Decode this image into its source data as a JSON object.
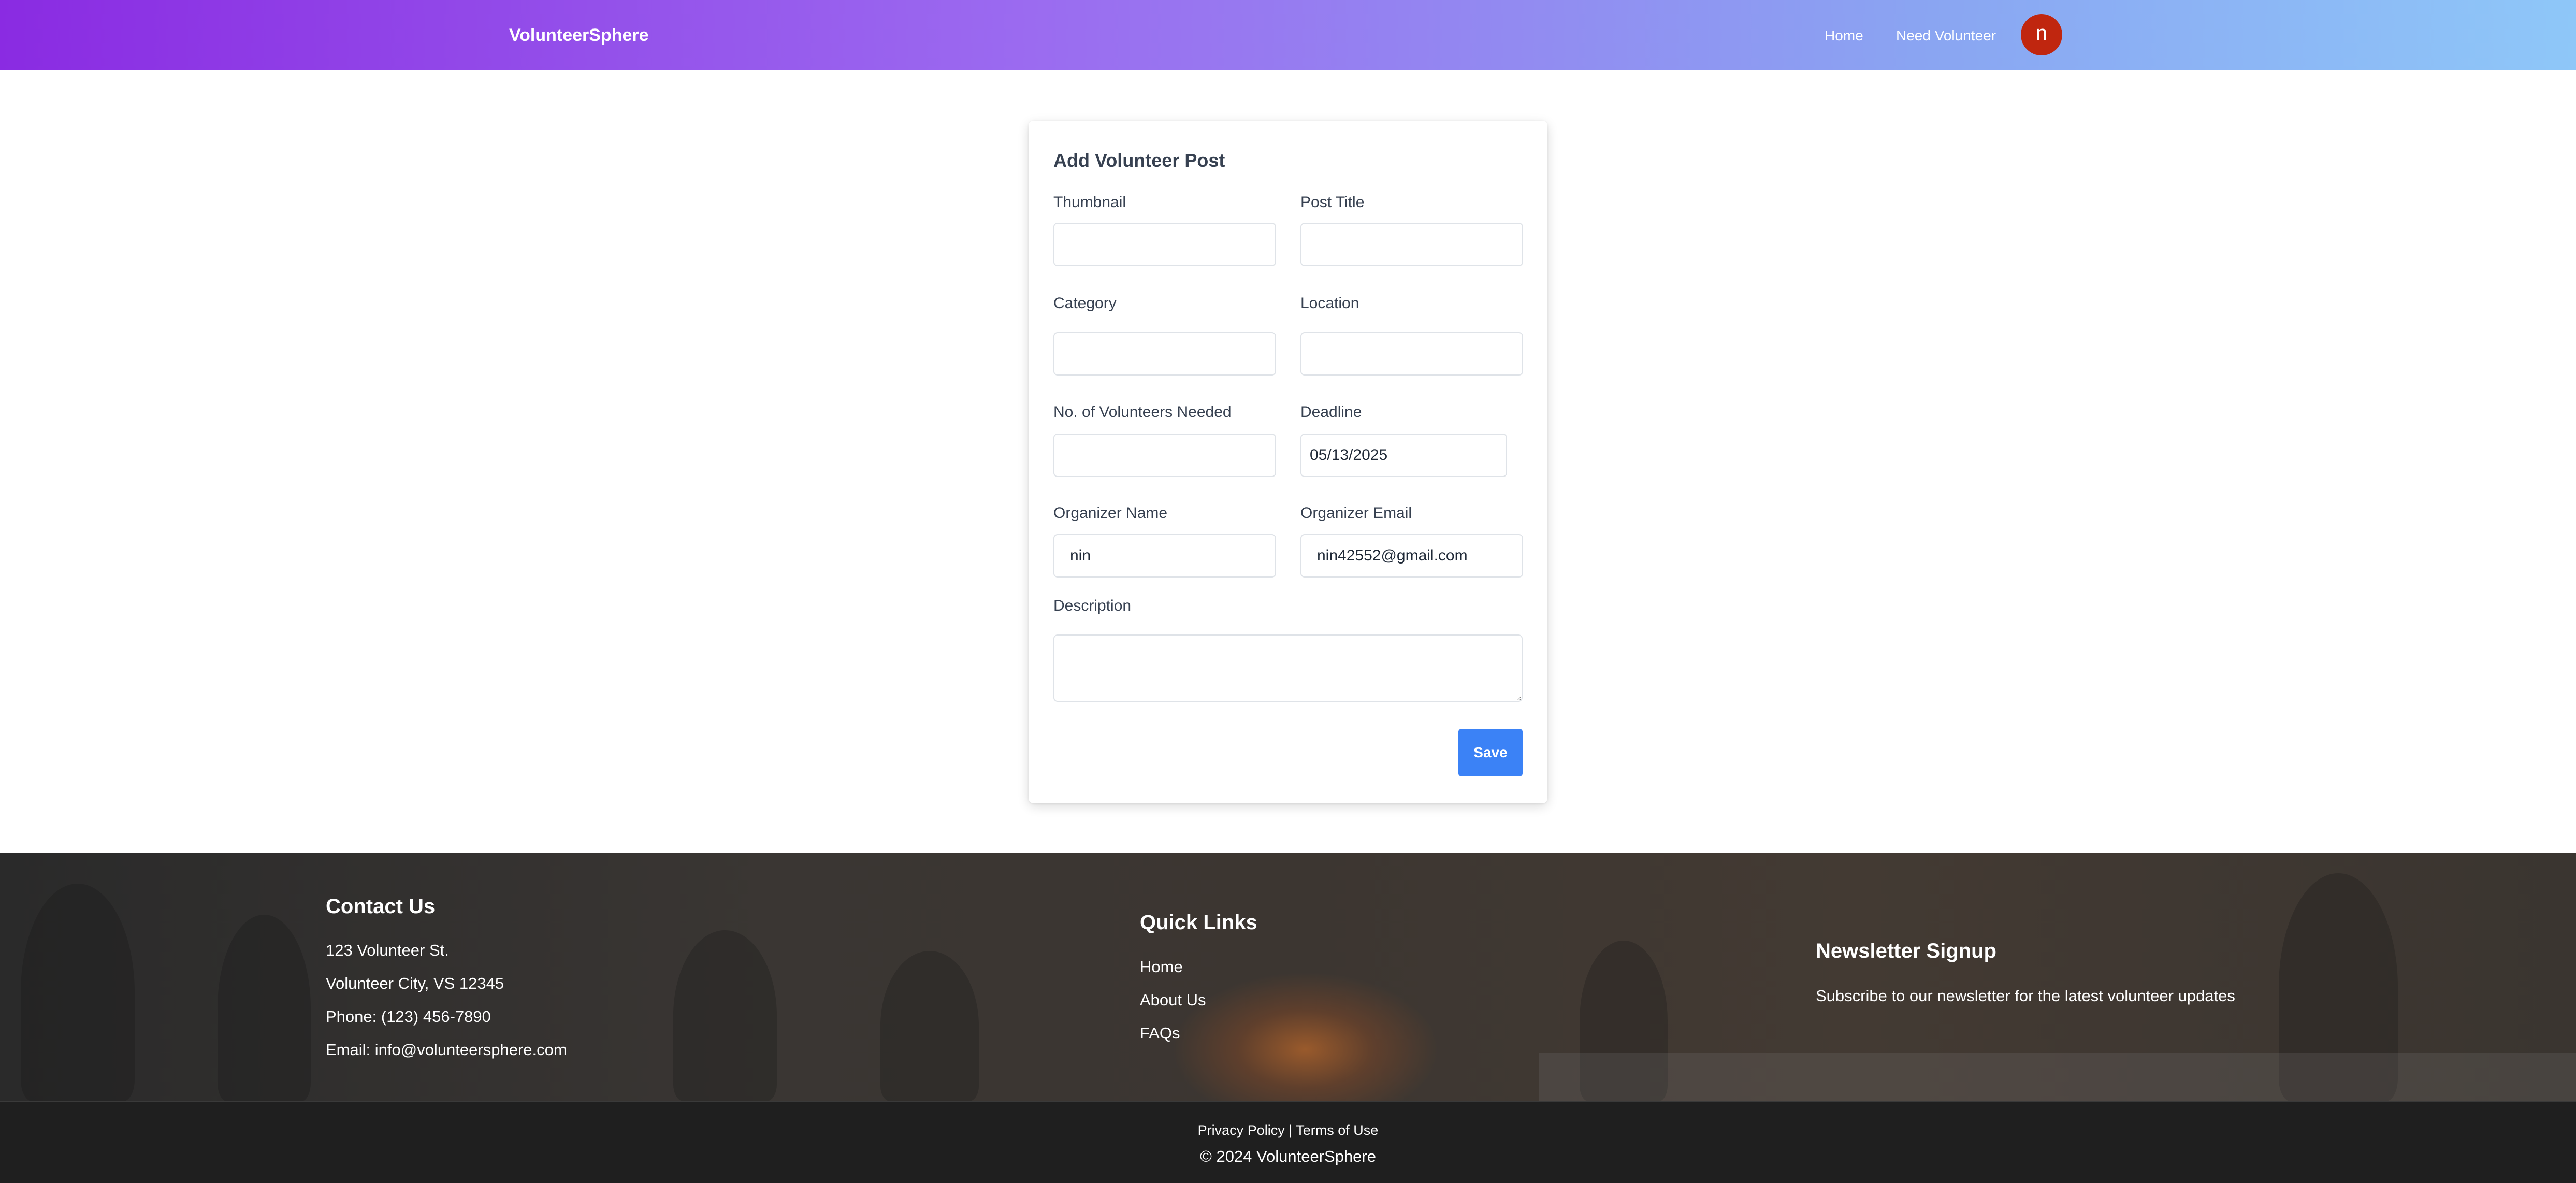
{
  "navbar": {
    "brand": "VolunteerSphere",
    "links": [
      "Home",
      "Need Volunteer"
    ],
    "avatar_initial": "n",
    "avatar_color": "#c0260f"
  },
  "form": {
    "title": "Add Volunteer Post",
    "fields": {
      "thumbnail": {
        "label": "Thumbnail",
        "value": ""
      },
      "post_title": {
        "label": "Post Title",
        "value": ""
      },
      "category": {
        "label": "Category",
        "value": ""
      },
      "location": {
        "label": "Location",
        "value": ""
      },
      "volunteers_needed": {
        "label": "No. of Volunteers Needed",
        "value": ""
      },
      "deadline": {
        "label": "Deadline",
        "value": "05/13/2025"
      },
      "organizer_name": {
        "label": "Organizer Name",
        "value": "nin"
      },
      "organizer_email": {
        "label": "Organizer Email",
        "value": "nin42552@gmail.com"
      },
      "description": {
        "label": "Description",
        "value": ""
      }
    },
    "save_label": "Save",
    "save_color": "#3b82f6"
  },
  "footer": {
    "contact": {
      "heading": "Contact Us",
      "address_line1": "123 Volunteer St.",
      "address_line2": "Volunteer City, VS 12345",
      "phone": "Phone: (123) 456-7890",
      "email": "Email: info@volunteersphere.com"
    },
    "quick_links": {
      "heading": "Quick Links",
      "items": [
        "Home",
        "About Us",
        "FAQs"
      ]
    },
    "newsletter": {
      "heading": "Newsletter Signup",
      "text": "Subscribe to our newsletter for the latest volunteer updates"
    }
  },
  "bottom_bar": {
    "privacy": "Privacy Policy",
    "separator": "|",
    "terms": "Terms of Use",
    "copyright": "© 2024 VolunteerSphere"
  },
  "theme": {
    "navbar_gradient_start": "#8a2be2",
    "navbar_gradient_end": "#8ec7f8",
    "footer_bg": "#2e2e2e",
    "bottom_bar_bg": "#1f1f1f"
  }
}
